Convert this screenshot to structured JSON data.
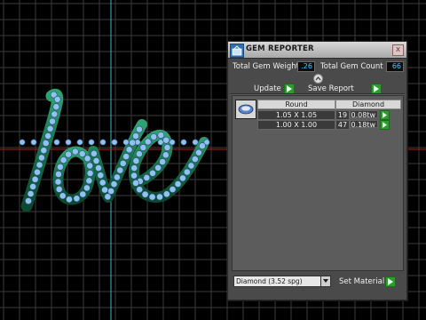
{
  "panel": {
    "title": "GEM REPORTER",
    "close_glyph": "x",
    "total_weight_label": "Total Gem Weight",
    "total_weight_value": ".26",
    "total_count_label": "Total Gem Count",
    "total_count_value": "66",
    "update_label": "Update",
    "save_report_label": "Save Report",
    "table": {
      "shape_header": "Round",
      "material_header": "Diamond",
      "rows": [
        {
          "size": "1.05 X 1.05",
          "count": "19",
          "weight": "0.08tw"
        },
        {
          "size": "1.00 X 1.00",
          "count": "47",
          "weight": "0.18tw"
        }
      ]
    },
    "material_select_value": "Diamond    (3.52 spg)",
    "set_material_label": "Set Material"
  },
  "icons": {
    "title": "gem-reporter-icon",
    "close": "close-icon",
    "collapse": "collapse-up-icon",
    "go": "play-arrow-icon",
    "thumb": "round-gem-icon",
    "dropdown": "chevron-down-icon"
  },
  "colors": {
    "viewport_bg": "#000000",
    "grid": "#3b3b3b",
    "grid_blue_axis": "#2fb7c9",
    "grid_red_axis": "#b31d1d",
    "model_green": "#1b7d55",
    "gem_blue": "#8fc2f2",
    "value_cyan": "#3fd3ff",
    "go_green": "#2f9a2f"
  }
}
